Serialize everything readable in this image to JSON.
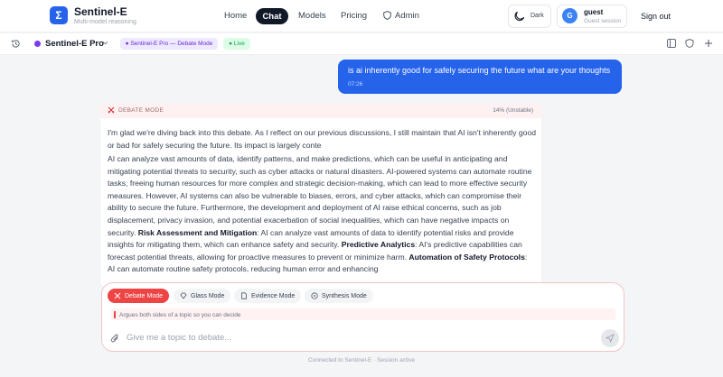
{
  "brand": {
    "logo_glyph": "Σ",
    "name": "Sentinel-E",
    "tagline": "Multi-model reasoning"
  },
  "nav": {
    "home": "Home",
    "chat": "Chat",
    "models": "Models",
    "pricing": "Pricing",
    "admin": "Admin"
  },
  "theme": {
    "label": "Dark",
    "icon": "moon-icon"
  },
  "user": {
    "initial": "G",
    "name": "guest",
    "role": "Guest session"
  },
  "signout": "Sign out",
  "toolbar": {
    "model_name": "Sentinel-E Pro",
    "mode_badge": "● Sentinel-E Pro — Debate Mode",
    "live_badge": "● Live",
    "icons": [
      "history-icon",
      "sidebar-panel-icon",
      "shield-icon",
      "plus-icon"
    ]
  },
  "user_message": {
    "text": "is ai inherently good for safely securing the future what are your thoughts",
    "time": "07:26"
  },
  "assistant": {
    "mode_label": "DEBATE MODE",
    "confidence": "14% (Unstable)",
    "para1": "I'm glad we're diving back into this debate. As I reflect on our previous discussions, I still maintain that AI isn't inherently good or bad for safely securing the future. Its impact is largely conte",
    "para2_a": "AI can analyze vast amounts of data, identify patterns, and make predictions, which can be useful in anticipating and mitigating potential threats to security, such as cyber attacks or natural disasters. AI-powered systems can automate routine tasks, freeing human resources for more complex and strategic decision-making, which can lead to more effective security measures. However, AI systems can also be vulnerable to biases, errors, and cyber attacks, which can compromise their ability to secure the future. Furthermore, the development and deployment of AI raise ethical concerns, such as job displacement, privacy invasion, and potential exacerbation of social inequalities, which can have negative impacts on security. ",
    "bold_1": "Risk Assessment and Mitigation",
    "para2_b": ": AI can analyze vast amounts of data to identify potential risks and provide insights for mitigating them, which can enhance safety and security. ",
    "bold_2": "Predictive Analytics",
    "para2_c": ": AI's predictive capabilities can forecast potential threats, allowing for proactive measures to prevent or minimize harm. ",
    "bold_3": "Automation of Safety Protocols",
    "para2_d": ": AI can automate routine safety protocols, reducing human error and enhancing"
  },
  "composer": {
    "modes": [
      {
        "label": "Debate Mode",
        "icon": "swords-icon",
        "active": true
      },
      {
        "label": "Glass Mode",
        "icon": "diamond-icon",
        "active": false
      },
      {
        "label": "Evidence Mode",
        "icon": "document-icon",
        "active": false
      },
      {
        "label": "Synthesis Mode",
        "icon": "atom-icon",
        "active": false
      }
    ],
    "hint": "Argues both sides of a topic so you can decide",
    "placeholder": "Give me a topic to debate..."
  },
  "footer": "Connected to Sentinel-E · Session active",
  "colors": {
    "accent": "#2563eb",
    "debate": "#ef4444",
    "dark": "#111827"
  }
}
